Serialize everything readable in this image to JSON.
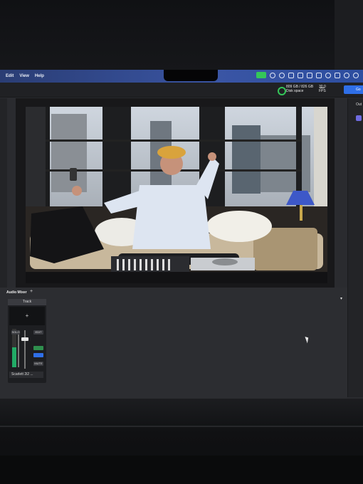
{
  "menubar": {
    "items": [
      "Edit",
      "View",
      "Help"
    ]
  },
  "status": {
    "disk_value": "809 GB / 826 GB",
    "disk_label": "Disk space",
    "fps_value": "30.0",
    "fps_label": "FPS",
    "go_label": "Go"
  },
  "right_panel": {
    "label": "Out"
  },
  "audio_mixer": {
    "title": "Audio Mixer",
    "add_label": "+",
    "track_tab": "Track",
    "strip_add": "+",
    "solo_label": "SOLO",
    "edit_label": "EDIT",
    "mute_label": "MUTE",
    "device_name": "Scarlett 2i2 ..."
  },
  "preview": {
    "description": "live camera preview"
  },
  "colors": {
    "accent": "#2f6fe8",
    "live_green": "#34c759",
    "menubar": "#3a55a4"
  }
}
